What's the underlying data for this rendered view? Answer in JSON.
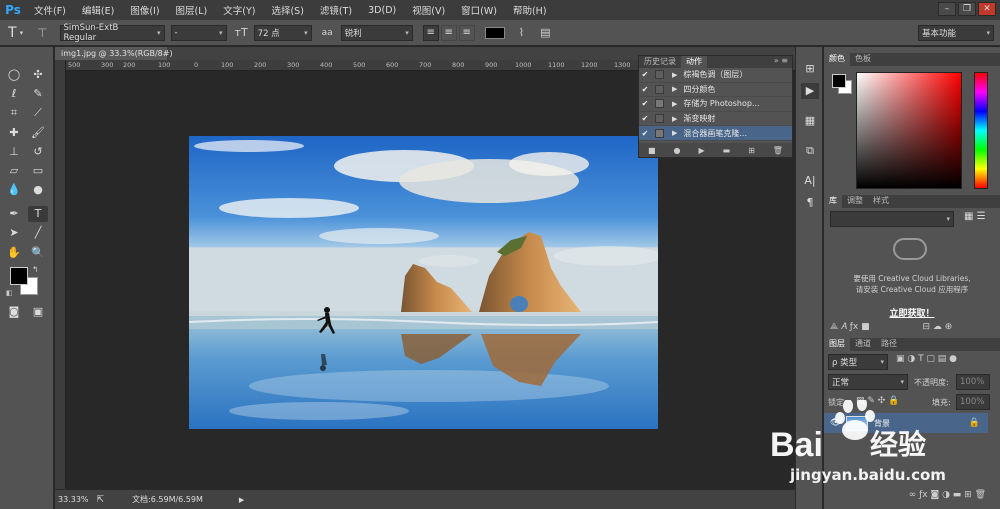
{
  "app": {
    "logo": "Ps"
  },
  "menu": [
    "文件(F)",
    "编辑(E)",
    "图像(I)",
    "图层(L)",
    "文字(Y)",
    "选择(S)",
    "滤镜(T)",
    "3D(D)",
    "视图(V)",
    "窗口(W)",
    "帮助(H)"
  ],
  "options_bar": {
    "font_family": "SimSun-ExtB Regular",
    "font_style": "-",
    "font_size": "72 点",
    "aa_label": "aa",
    "antialias": "锐利",
    "workspace": "基本功能",
    "text_color": "#000000"
  },
  "document": {
    "tab_title": "img1.jpg @ 33.3%(RGB/8#)",
    "ruler_ticks": [
      "500",
      "300",
      "200",
      "100",
      "0",
      "100",
      "200",
      "300",
      "400",
      "500",
      "600",
      "700",
      "800",
      "900",
      "1000",
      "1100",
      "1200",
      "1300",
      "1400",
      "1500",
      "1600",
      "1700",
      "180"
    ]
  },
  "status": {
    "zoom": "33.33%",
    "doc_info": "文档:6.59M/6.59M"
  },
  "actions_panel": {
    "tabs": [
      "历史记录",
      "动作"
    ],
    "items": [
      "棕褐色调（图层）",
      "四分颜色",
      "存储为 Photoshop...",
      "渐变映射",
      "混合器画笔克隆..."
    ]
  },
  "color_panel": {
    "tabs": [
      "颜色",
      "色板"
    ],
    "foreground": "#000000",
    "background": "#ffffff"
  },
  "library_panel": {
    "tabs": [
      "库",
      "调整",
      "样式"
    ],
    "message_line1": "要使用 Creative Cloud Libraries,",
    "message_line2": "请安装 Creative Cloud 应用程序",
    "link": "立即获取！"
  },
  "layers_panel": {
    "tabs": [
      "图层",
      "通道",
      "路径"
    ],
    "filter": "类型",
    "blend_mode": "正常",
    "opacity_label": "不透明度:",
    "opacity": "100%",
    "lock_label": "锁定:",
    "fill_label": "填充:",
    "fill": "100%",
    "layer_name": "背景"
  },
  "watermark": {
    "brand": "Bai",
    "brand2": "经验",
    "url": "jingyan.baidu.com"
  }
}
